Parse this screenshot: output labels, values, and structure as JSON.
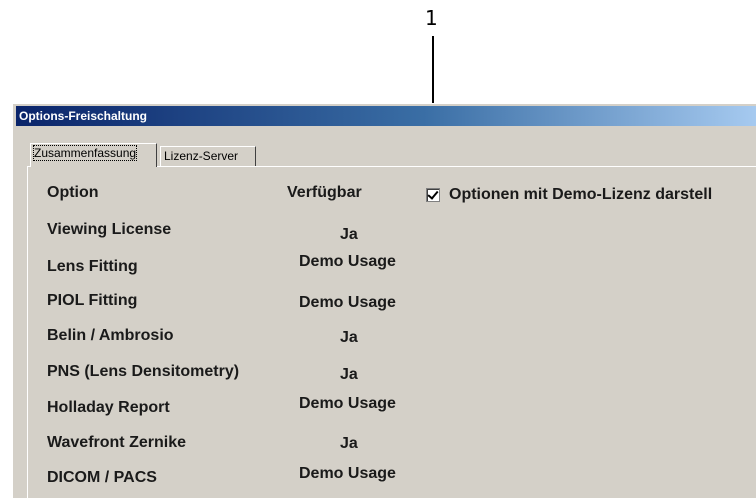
{
  "callout": {
    "label": "1"
  },
  "window": {
    "title": "Options-Freischaltung"
  },
  "tabs": [
    {
      "label": "Zusammenfassung",
      "active": true
    },
    {
      "label": "Lizenz-Server",
      "active": false
    }
  ],
  "table": {
    "headers": {
      "option": "Option",
      "available": "Verfügbar"
    },
    "rows": [
      {
        "option": "Viewing License",
        "available": "Ja"
      },
      {
        "option": "Lens Fitting",
        "available": "Demo Usage"
      },
      {
        "option": "PIOL Fitting",
        "available": "Demo Usage"
      },
      {
        "option": "Belin / Ambrosio",
        "available": "Ja"
      },
      {
        "option": "PNS (Lens Densitometry)",
        "available": "Ja"
      },
      {
        "option": "Holladay Report",
        "available": "Demo Usage"
      },
      {
        "option": "Wavefront Zernike",
        "available": "Ja"
      },
      {
        "option": "DICOM / PACS",
        "available": "Demo Usage"
      }
    ]
  },
  "checkbox": {
    "label": "Optionen mit Demo-Lizenz darstell",
    "checked": true
  }
}
